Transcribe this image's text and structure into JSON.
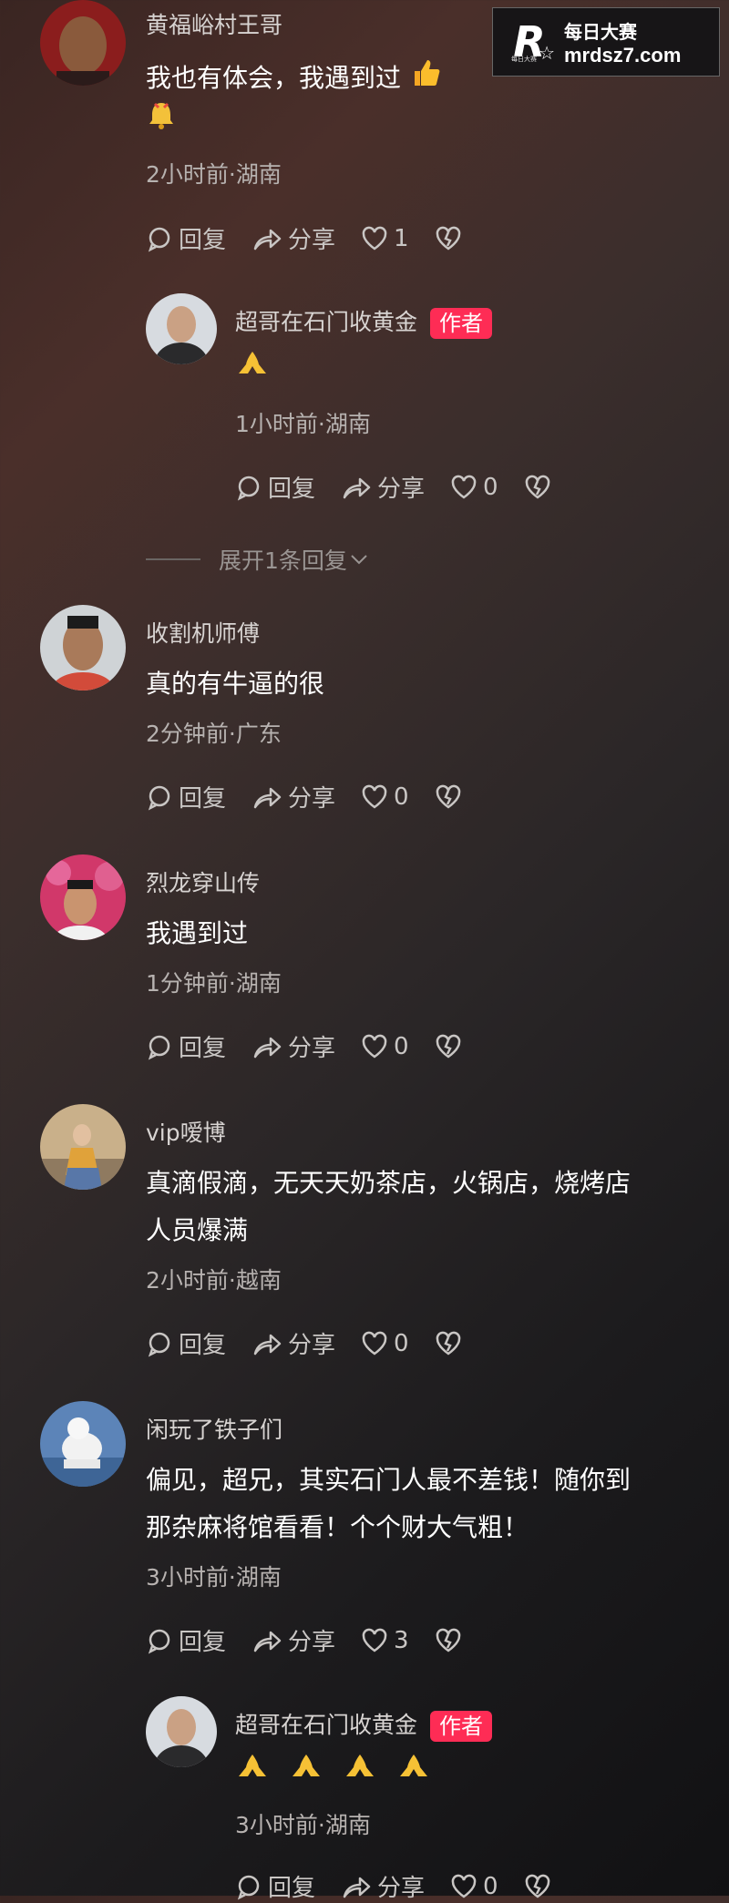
{
  "watermark": {
    "logo_letter": "R",
    "logo_small": "每日大赛",
    "title_cn": "每日大赛",
    "title_en": "mrdsz7.com"
  },
  "actions_labels": {
    "reply": "回复",
    "share": "分享"
  },
  "expand_replies": "展开1条回复",
  "comments": [
    {
      "name": "黄福峪村王哥",
      "text_line1": "我也有体会，我遇到过",
      "meta": "2小时前·湖南",
      "likes": "1",
      "reply": {
        "name": "超哥在石门收黄金",
        "badge": "作者",
        "meta": "1小时前·湖南",
        "likes": "0"
      }
    },
    {
      "name": "收割机师傅",
      "text_line1": "真的有牛逼的很",
      "meta": "2分钟前·广东",
      "likes": "0"
    },
    {
      "name": "烈龙穿山传",
      "text_line1": "我遇到过",
      "meta": "1分钟前·湖南",
      "likes": "0"
    },
    {
      "name": "vip嗳博",
      "text_line1": "真滴假滴，无天天奶茶店，火锅店，烧烤店",
      "text_line2": "人员爆满",
      "meta": "2小时前·越南",
      "likes": "0"
    },
    {
      "name": "闲玩了铁子们",
      "text_line1": "偏见，超兄，其实石门人最不差钱！随你到",
      "text_line2": "那杂麻将馆看看！个个财大气粗！",
      "meta": "3小时前·湖南",
      "likes": "3",
      "reply": {
        "name": "超哥在石门收黄金",
        "badge": "作者",
        "meta": "3小时前·湖南",
        "likes": "0"
      }
    }
  ],
  "colors": {
    "author_badge": "#fe2c55",
    "meta": "#b7b2b0"
  }
}
